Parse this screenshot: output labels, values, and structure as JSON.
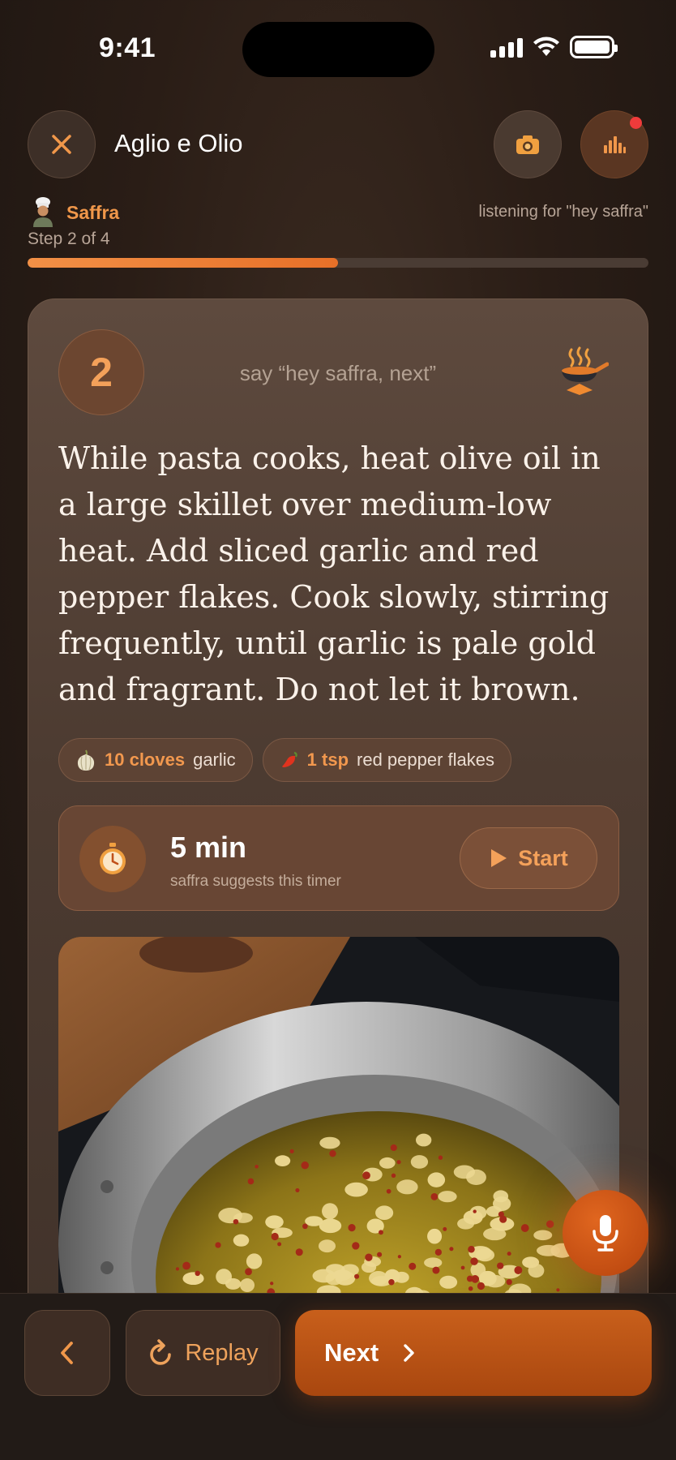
{
  "status_bar": {
    "time": "9:41"
  },
  "header": {
    "title": "Aglio e Olio",
    "close_icon": "close-icon",
    "camera_icon": "camera-icon",
    "audio_icon": "audio-levels-icon"
  },
  "assistant": {
    "name": "Saffra",
    "listening_text": "listening for \"hey saffra\""
  },
  "progress": {
    "step_label": "Step 2 of 4",
    "current_step": 2,
    "total_steps": 4,
    "fraction": 0.5
  },
  "step": {
    "number": "2",
    "voice_hint": "say “hey saffra, next”",
    "instruction": "While pasta cooks, heat olive oil in a large skillet over medium-low heat. Add sliced garlic and red pepper flakes. Cook slowly, stirring frequently, until garlic is pale gold and fragrant. Do not let it brown.",
    "ingredients": [
      {
        "qty": "10 cloves",
        "name": "garlic",
        "icon": "garlic-icon"
      },
      {
        "qty": "1 tsp",
        "name": "red pepper flakes",
        "icon": "chili-icon"
      }
    ]
  },
  "timer": {
    "value": "5 min",
    "subtitle": "saffra suggests this timer",
    "start_label": "Start"
  },
  "photo": {
    "subject": "garlic-in-skillet-photo"
  },
  "bottom_bar": {
    "back_icon": "chevron-left-icon",
    "replay_label": "Replay",
    "next_label": "Next"
  },
  "colors": {
    "accent": "#f0974a",
    "button_orange": "#c85f1b",
    "background": "#2a1d16",
    "notification_dot": "#ef3b3b"
  }
}
